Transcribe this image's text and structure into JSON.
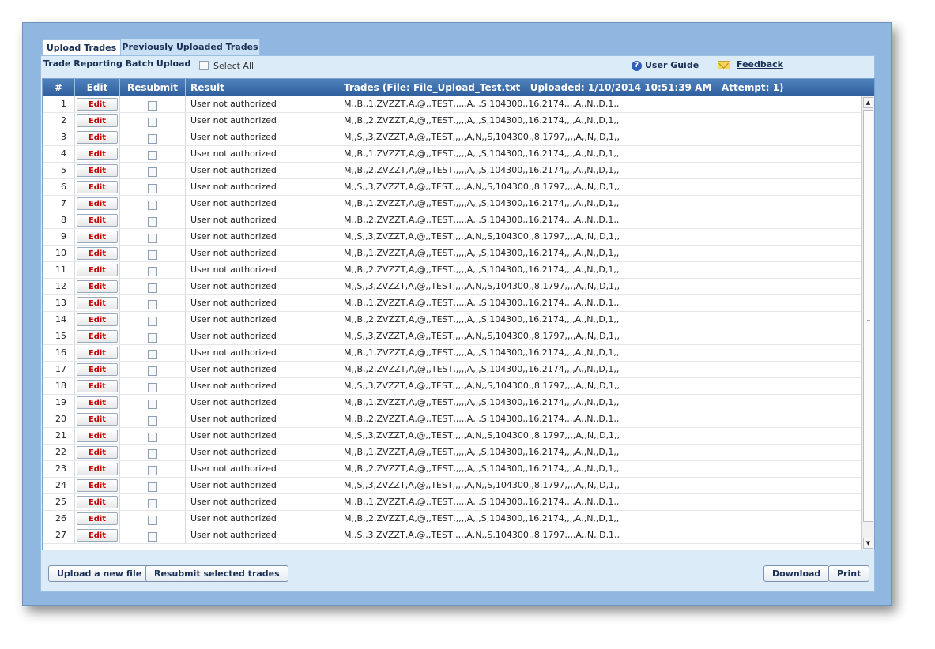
{
  "tabs": [
    "Upload Trades",
    "Previously Uploaded Trades"
  ],
  "toolbar": {
    "batch_title": "Trade Reporting Batch Upload",
    "select_all_label": "Select All",
    "user_guide_label": "User Guide",
    "feedback_label": "Feedback"
  },
  "grid": {
    "headers": {
      "num": "#",
      "edit": "Edit",
      "resubmit": "Resubmit",
      "result": "Result",
      "trades": "Trades (File: File_Upload_Test.txt   Uploaded: 1/10/2014 10:51:39 AM   Attempt: 1)"
    },
    "edit_label": "Edit",
    "rows": [
      {
        "num": "1",
        "result": "User not authorized",
        "trade": "M,,B,,1,ZVZZT,A,@,,TEST,,,,,A,,,S,104300,,16.2174,,,,A,,N,,D,1,,"
      },
      {
        "num": "2",
        "result": "User not authorized",
        "trade": "M,,B,,2,ZVZZT,A,@,,TEST,,,,,A,,,S,104300,,16.2174,,,,A,,N,,D,1,,"
      },
      {
        "num": "3",
        "result": "User not authorized",
        "trade": "M,,S,,3,ZVZZT,A,@,,TEST,,,,,A,N,,S,104300,,8.1797,,,,A,,N,,D,1,,"
      },
      {
        "num": "4",
        "result": "User not authorized",
        "trade": "M,,B,,1,ZVZZT,A,@,,TEST,,,,,A,,,S,104300,,16.2174,,,,A,,N,,D,1,,"
      },
      {
        "num": "5",
        "result": "User not authorized",
        "trade": "M,,B,,2,ZVZZT,A,@,,TEST,,,,,A,,,S,104300,,16.2174,,,,A,,N,,D,1,,"
      },
      {
        "num": "6",
        "result": "User not authorized",
        "trade": "M,,S,,3,ZVZZT,A,@,,TEST,,,,,A,N,,S,104300,,8.1797,,,,A,,N,,D,1,,"
      },
      {
        "num": "7",
        "result": "User not authorized",
        "trade": "M,,B,,1,ZVZZT,A,@,,TEST,,,,,A,,,S,104300,,16.2174,,,,A,,N,,D,1,,"
      },
      {
        "num": "8",
        "result": "User not authorized",
        "trade": "M,,B,,2,ZVZZT,A,@,,TEST,,,,,A,,,S,104300,,16.2174,,,,A,,N,,D,1,,"
      },
      {
        "num": "9",
        "result": "User not authorized",
        "trade": "M,,S,,3,ZVZZT,A,@,,TEST,,,,,A,N,,S,104300,,8.1797,,,,A,,N,,D,1,,"
      },
      {
        "num": "10",
        "result": "User not authorized",
        "trade": "M,,B,,1,ZVZZT,A,@,,TEST,,,,,A,,,S,104300,,16.2174,,,,A,,N,,D,1,,"
      },
      {
        "num": "11",
        "result": "User not authorized",
        "trade": "M,,B,,2,ZVZZT,A,@,,TEST,,,,,A,,,S,104300,,16.2174,,,,A,,N,,D,1,,"
      },
      {
        "num": "12",
        "result": "User not authorized",
        "trade": "M,,S,,3,ZVZZT,A,@,,TEST,,,,,A,N,,S,104300,,8.1797,,,,A,,N,,D,1,,"
      },
      {
        "num": "13",
        "result": "User not authorized",
        "trade": "M,,B,,1,ZVZZT,A,@,,TEST,,,,,A,,,S,104300,,16.2174,,,,A,,N,,D,1,,"
      },
      {
        "num": "14",
        "result": "User not authorized",
        "trade": "M,,B,,2,ZVZZT,A,@,,TEST,,,,,A,,,S,104300,,16.2174,,,,A,,N,,D,1,,"
      },
      {
        "num": "15",
        "result": "User not authorized",
        "trade": "M,,S,,3,ZVZZT,A,@,,TEST,,,,,A,N,,S,104300,,8.1797,,,,A,,N,,D,1,,"
      },
      {
        "num": "16",
        "result": "User not authorized",
        "trade": "M,,B,,1,ZVZZT,A,@,,TEST,,,,,A,,,S,104300,,16.2174,,,,A,,N,,D,1,,"
      },
      {
        "num": "17",
        "result": "User not authorized",
        "trade": "M,,B,,2,ZVZZT,A,@,,TEST,,,,,A,,,S,104300,,16.2174,,,,A,,N,,D,1,,"
      },
      {
        "num": "18",
        "result": "User not authorized",
        "trade": "M,,S,,3,ZVZZT,A,@,,TEST,,,,,A,N,,S,104300,,8.1797,,,,A,,N,,D,1,,"
      },
      {
        "num": "19",
        "result": "User not authorized",
        "trade": "M,,B,,1,ZVZZT,A,@,,TEST,,,,,A,,,S,104300,,16.2174,,,,A,,N,,D,1,,"
      },
      {
        "num": "20",
        "result": "User not authorized",
        "trade": "M,,B,,2,ZVZZT,A,@,,TEST,,,,,A,,,S,104300,,16.2174,,,,A,,N,,D,1,,"
      },
      {
        "num": "21",
        "result": "User not authorized",
        "trade": "M,,S,,3,ZVZZT,A,@,,TEST,,,,,A,N,,S,104300,,8.1797,,,,A,,N,,D,1,,"
      },
      {
        "num": "22",
        "result": "User not authorized",
        "trade": "M,,B,,1,ZVZZT,A,@,,TEST,,,,,A,,,S,104300,,16.2174,,,,A,,N,,D,1,,"
      },
      {
        "num": "23",
        "result": "User not authorized",
        "trade": "M,,B,,2,ZVZZT,A,@,,TEST,,,,,A,,,S,104300,,16.2174,,,,A,,N,,D,1,,"
      },
      {
        "num": "24",
        "result": "User not authorized",
        "trade": "M,,S,,3,ZVZZT,A,@,,TEST,,,,,A,N,,S,104300,,8.1797,,,,A,,N,,D,1,,"
      },
      {
        "num": "25",
        "result": "User not authorized",
        "trade": "M,,B,,1,ZVZZT,A,@,,TEST,,,,,A,,,S,104300,,16.2174,,,,A,,N,,D,1,,"
      },
      {
        "num": "26",
        "result": "User not authorized",
        "trade": "M,,B,,2,ZVZZT,A,@,,TEST,,,,,A,,,S,104300,,16.2174,,,,A,,N,,D,1,,"
      },
      {
        "num": "27",
        "result": "User not authorized",
        "trade": "M,,S,,3,ZVZZT,A,@,,TEST,,,,,A,N,,S,104300,,8.1797,,,,A,,N,,D,1,,"
      }
    ]
  },
  "footer": {
    "upload_label": "Upload a new file",
    "resubmit_label": "Resubmit selected trades",
    "download_label": "Download",
    "print_label": "Print"
  },
  "icons": {
    "help": "question-circle-icon",
    "feedback": "envelope-icon",
    "scroll_up": "triangle-up-icon",
    "scroll_down": "triangle-down-icon"
  },
  "colors": {
    "frame_bg": "#8fb7e0",
    "panel_bg": "#dcebf8",
    "header_bg": "#3a6aa8",
    "edit_text": "#c80000",
    "label_text": "#1a2f55"
  }
}
